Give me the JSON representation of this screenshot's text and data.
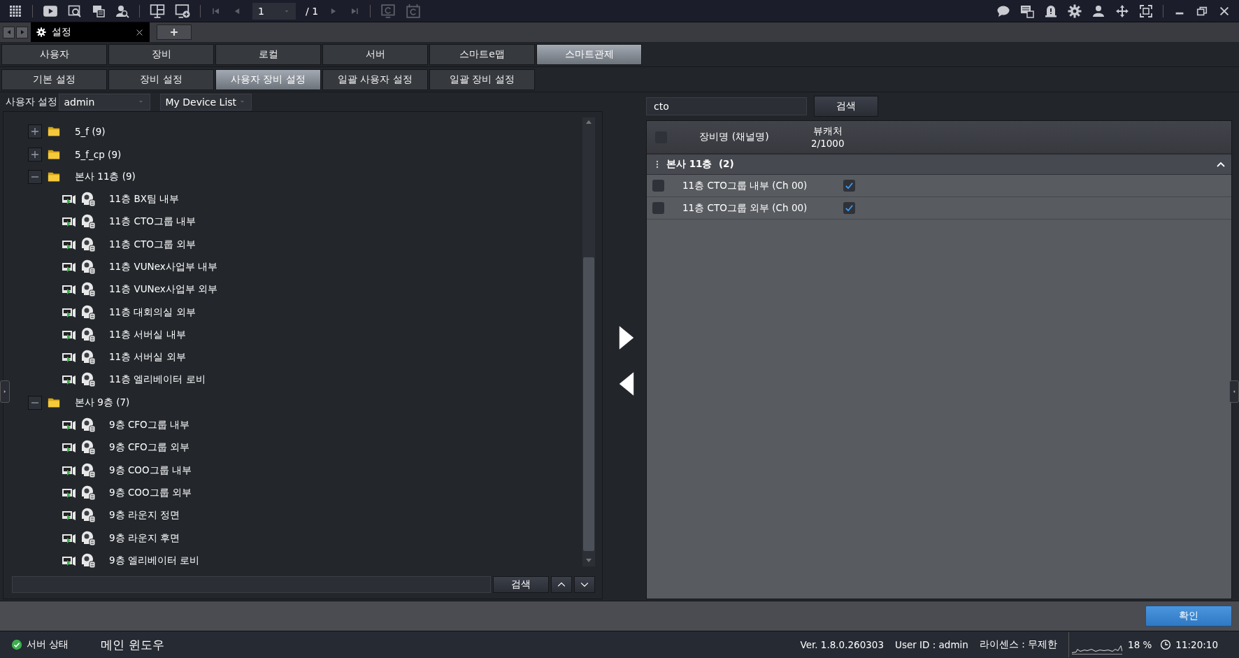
{
  "toolbar": {
    "page": "1",
    "page_total": "/ 1"
  },
  "window_tabs": [
    {
      "label": "설정",
      "selected": true
    }
  ],
  "main_tabs": [
    {
      "label": "사용자",
      "selected": false
    },
    {
      "label": "장비",
      "selected": false
    },
    {
      "label": "로컬",
      "selected": false
    },
    {
      "label": "서버",
      "selected": false
    },
    {
      "label": "스마트e맵",
      "selected": false
    },
    {
      "label": "스마트관제",
      "selected": true
    }
  ],
  "sub_tabs": [
    {
      "label": "기본 설정",
      "selected": false
    },
    {
      "label": "장비 설정",
      "selected": false
    },
    {
      "label": "사용자 장비 설정",
      "selected": true
    },
    {
      "label": "일괄 사용자 설정",
      "selected": false
    },
    {
      "label": "일괄 장비 설정",
      "selected": false
    }
  ],
  "user_settings": {
    "label": "사용자 설정",
    "user": "admin",
    "list": "My Device List"
  },
  "tree": {
    "items": [
      {
        "kind": "folder",
        "label": "5_f (9)",
        "expanded": false
      },
      {
        "kind": "folder",
        "label": "5_f_cp (9)",
        "expanded": false
      },
      {
        "kind": "folder",
        "label": "본사 11층 (9)",
        "expanded": true,
        "children": [
          {
            "kind": "camera",
            "label": "11층 BX팀 내부"
          },
          {
            "kind": "camera",
            "label": "11층 CTO그룹 내부"
          },
          {
            "kind": "camera",
            "label": "11층 CTO그룹 외부"
          },
          {
            "kind": "camera",
            "label": "11층 VUNex사업부 내부"
          },
          {
            "kind": "camera",
            "label": "11층 VUNex사업부 외부"
          },
          {
            "kind": "camera",
            "label": "11층 대회의실 외부"
          },
          {
            "kind": "camera",
            "label": "11층 서버실 내부"
          },
          {
            "kind": "camera",
            "label": "11층 서버실 외부"
          },
          {
            "kind": "camera",
            "label": "11층 엘리베이터 로비"
          }
        ]
      },
      {
        "kind": "folder",
        "label": "본사 9층 (7)",
        "expanded": true,
        "children": [
          {
            "kind": "camera",
            "label": "9층 CFO그룹 내부"
          },
          {
            "kind": "camera",
            "label": "9층 CFO그룹 외부"
          },
          {
            "kind": "camera",
            "label": "9층 COO그룹 내부"
          },
          {
            "kind": "camera",
            "label": "9층 COO그룹 외부"
          },
          {
            "kind": "camera",
            "label": "9층 라운지 정면"
          },
          {
            "kind": "camera",
            "label": "9층 라운지 후면"
          },
          {
            "kind": "camera",
            "label": "9층 엘리베이터 로비"
          }
        ]
      }
    ]
  },
  "tree_search": {
    "button": "검색"
  },
  "right_panel": {
    "search": {
      "value": "cto",
      "button": "검색"
    },
    "table": {
      "all_checked": false,
      "columns": [
        "장비명 (채널명)",
        "뷰캐처"
      ],
      "viewcatcher_count": "2/1000",
      "groups": [
        {
          "label": "본사 11층  (2)",
          "expanded": true,
          "rows": [
            {
              "name": "11층 CTO그룹 내부 (Ch 00)",
              "checked": false,
              "viewcatcher": true
            },
            {
              "name": "11층 CTO그룹 외부 (Ch 00)",
              "checked": false,
              "viewcatcher": true
            }
          ]
        }
      ]
    }
  },
  "confirm_button": "확인",
  "status_bar": {
    "server_status": "서버 상태",
    "main_window": "메인 윈도우",
    "version": "Ver. 1.8.0.260303",
    "user_id": "User ID : admin",
    "license": "라이센스 : 무제한",
    "cpu": "18 %",
    "time": "11:20:10"
  }
}
